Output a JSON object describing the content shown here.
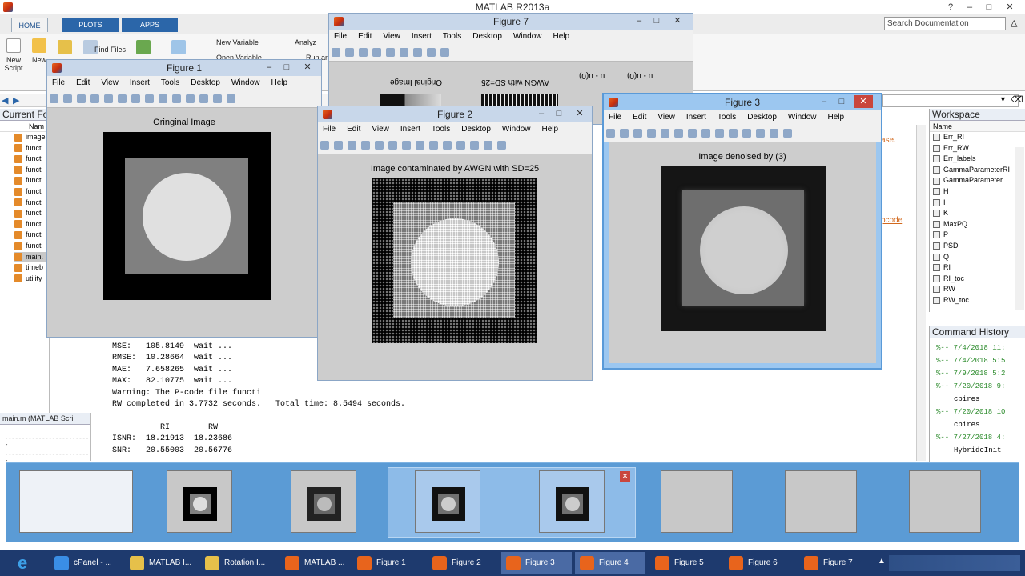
{
  "window": {
    "title": "MATLAB R2013a"
  },
  "ribbon": {
    "tabs": [
      "HOME",
      "PLOTS",
      "APPS"
    ],
    "buttons": {
      "new_script": "New Script",
      "new": "New",
      "find_files": "Find Files",
      "new_variable": "New Variable",
      "open_variable": "Open Variable",
      "analyze": "Analyz",
      "run": "Run an"
    },
    "search_placeholder": "Search Documentation"
  },
  "current_folder": {
    "title": "Current Fo",
    "col_name": "Nam",
    "items": [
      "image",
      "functi",
      "functi",
      "functi",
      "functi",
      "functi",
      "functi",
      "functi",
      "functi",
      "functi",
      "functi",
      "main.",
      "timeb",
      "utility"
    ]
  },
  "details": {
    "title": "main.m (MATLAB Scri",
    "dashes1": "--------------------------",
    "dashes2": "--------------------------"
  },
  "workspace": {
    "title": "Workspace",
    "col_name": "Name",
    "items": [
      "Err_RI",
      "Err_RW",
      "Err_labels",
      "GammaParameterRI",
      "GammaParameter...",
      "H",
      "I",
      "K",
      "MaxPQ",
      "P",
      "PSD",
      "Q",
      "RI",
      "RI_toc",
      "RW",
      "RW_toc"
    ]
  },
  "editor_snips": {
    "s1": "ase.",
    "s2": "pcode"
  },
  "command_history": {
    "title": "Command History",
    "items": [
      "%-- 7/4/2018 11:",
      "%-- 7/4/2018 5:5",
      "%-- 7/9/2018 5:2",
      "%-- 7/20/2018 9:",
      "cbires",
      "%-- 7/20/2018 10",
      "cbires",
      "%-- 7/27/2018 4:",
      "HybrideInit"
    ]
  },
  "console": {
    "lines": [
      "MSE:   105.8149  wait ...",
      "RMSE:  10.28664  wait ...",
      "MAE:   7.658265  wait ...",
      "MAX:   82.10775  wait ...",
      "Warning: The P-code file functi",
      "RW completed in 3.7732 seconds.   Total time: 8.5494 seconds.",
      "",
      "          RI        RW",
      "ISNR:  18.21913  18.23686",
      "SNR:   20.55003  20.56776"
    ]
  },
  "figure_menu": [
    "File",
    "Edit",
    "View",
    "Insert",
    "Tools",
    "Desktop",
    "Window",
    "Help"
  ],
  "figures": {
    "f1": {
      "title": "Figure 1",
      "axes_title": "Oringinal Image"
    },
    "f2": {
      "title": "Figure 2",
      "axes_title": "Image contaminated by AWGN with SD=25"
    },
    "f3": {
      "title": "Figure 3",
      "axes_title": "Image denoised by (3)"
    },
    "f7": {
      "title": "Figure 7",
      "t1": "Original Image",
      "t2": "AWGN with SD=25",
      "t3": "u - u(0)",
      "t4": "u - u(0)"
    }
  },
  "taskbar": {
    "items": [
      "cPanel - ...",
      "MATLAB I...",
      "Rotation I...",
      "MATLAB ...",
      "Figure 1",
      "Figure 2",
      "Figure 3",
      "Figure 4",
      "Figure 5",
      "Figure 6",
      "Figure 7"
    ]
  },
  "colors": {
    "accent": "#2b66a9",
    "taskbar": "#1e3a6e",
    "strip": "#5b9bd5",
    "close": "#c9463d"
  }
}
